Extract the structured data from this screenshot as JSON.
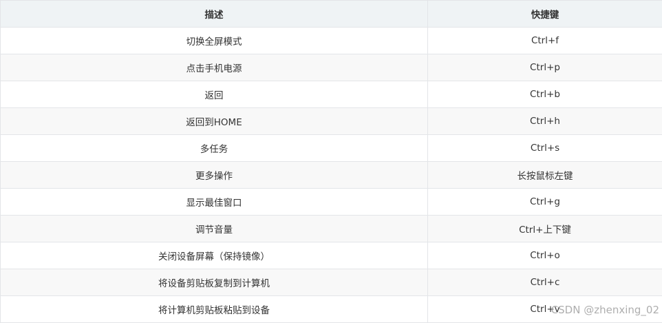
{
  "table": {
    "headers": [
      "描述",
      "快捷键"
    ],
    "rows": [
      [
        "切换全屏模式",
        "Ctrl+f"
      ],
      [
        "点击手机电源",
        "Ctrl+p"
      ],
      [
        "返回",
        "Ctrl+b"
      ],
      [
        "返回到HOME",
        "Ctrl+h"
      ],
      [
        "多任务",
        "Ctrl+s"
      ],
      [
        "更多操作",
        "长按鼠标左键"
      ],
      [
        "显示最佳窗口",
        "Ctrl+g"
      ],
      [
        "调节音量",
        "Ctrl+上下键"
      ],
      [
        "关闭设备屏幕（保持镜像）",
        "Ctrl+o"
      ],
      [
        "将设备剪贴板复制到计算机",
        "Ctrl+c"
      ],
      [
        "将计算机剪贴板粘贴到设备",
        "Ctrl+v"
      ]
    ]
  },
  "watermark": "CSDN @zhenxing_02"
}
